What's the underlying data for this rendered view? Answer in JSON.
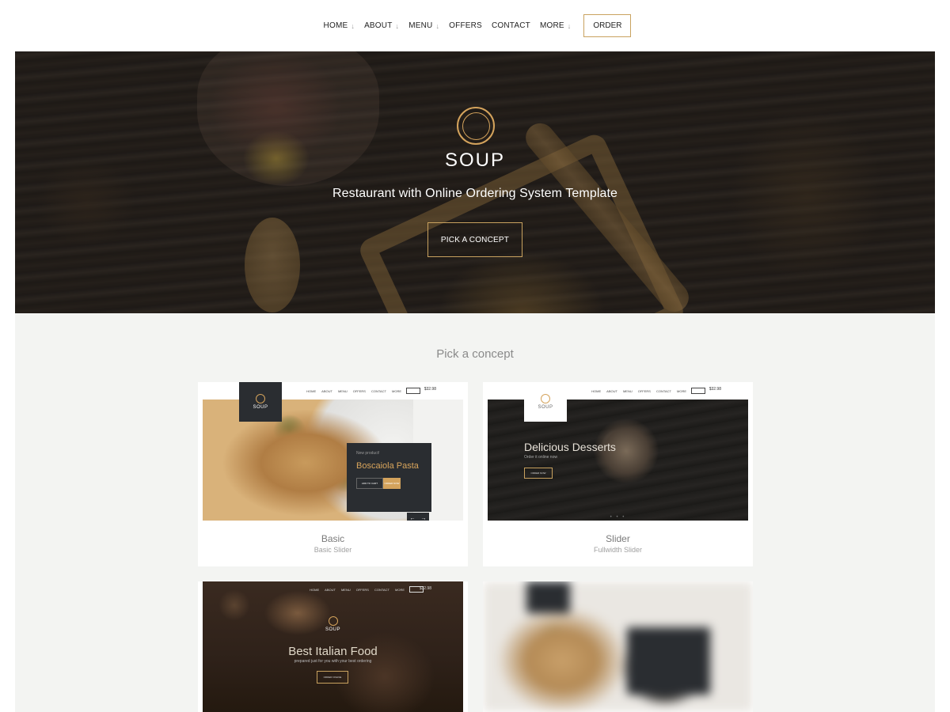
{
  "nav": {
    "items": [
      {
        "label": "HOME",
        "has_dropdown": true
      },
      {
        "label": "ABOUT",
        "has_dropdown": true
      },
      {
        "label": "MENU",
        "has_dropdown": true
      },
      {
        "label": "OFFERS",
        "has_dropdown": false
      },
      {
        "label": "CONTACT",
        "has_dropdown": false
      },
      {
        "label": "MORE",
        "has_dropdown": true
      }
    ],
    "order_label": "ORDER",
    "arrow_icon": "↓"
  },
  "hero": {
    "logo_text": "SOUP",
    "tagline": "Restaurant with Online Ordering System Template",
    "button_label": "PICK A CONCEPT"
  },
  "concepts": {
    "section_title": "Pick a concept",
    "cards": [
      {
        "title": "Basic",
        "subtitle": "Basic Slider",
        "preview": {
          "logo_text": "SOUP",
          "nav_links": [
            "HOME",
            "ABOUT",
            "MENU",
            "OFFERS",
            "CONTACT",
            "MORE"
          ],
          "order_label": "ORDER",
          "cart_amount": "$32.98",
          "promo_small": "New product!",
          "promo_title": "Boscaiola Pasta",
          "btn_add": "ADD TO CART",
          "btn_order": "ORDER NOW",
          "arrow_prev": "←",
          "arrow_next": "→"
        }
      },
      {
        "title": "Slider",
        "subtitle": "Fullwidth Slider",
        "preview": {
          "logo_text": "SOUP",
          "nav_links": [
            "HOME",
            "ABOUT",
            "MENU",
            "OFFERS",
            "CONTACT",
            "MORE"
          ],
          "order_label": "ORDER",
          "cart_amount": "$32.98",
          "slide_title": "Delicious Desserts",
          "slide_sub": "Order it online now",
          "slide_btn": "ORDER NOW",
          "dots": "• • •"
        }
      },
      {
        "preview": {
          "logo_text": "SOUP",
          "nav_links": [
            "HOME",
            "ABOUT",
            "MENU",
            "OFFERS",
            "CONTACT",
            "MORE"
          ],
          "order_label": "ORDER",
          "cart_amount": "$32.98",
          "slide_title": "Best Italian Food",
          "slide_sub": "prepared just for you with your best ordering",
          "slide_btn": "ORDER ONLINE"
        }
      },
      {}
    ]
  },
  "colors": {
    "accent": "#c9a25f",
    "dark_panel": "#2a2d31",
    "section_bg": "#f3f4f2"
  },
  "icons": {
    "logo": "soup-ring-logo-icon",
    "nav_dropdown": "arrow-down-icon",
    "cart": "cart-icon"
  }
}
